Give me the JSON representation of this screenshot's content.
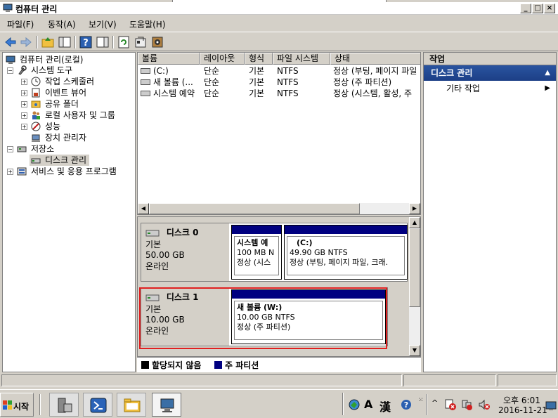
{
  "window": {
    "title": "컴퓨터 관리"
  },
  "menu": [
    "파일(F)",
    "동작(A)",
    "보기(V)",
    "도움말(H)"
  ],
  "tree": [
    {
      "label": "컴퓨터 관리(로컬)",
      "icon": "computer-management-icon"
    },
    {
      "label": "시스템 도구",
      "icon": "tools-icon"
    },
    {
      "label": "작업 스케줄러",
      "icon": "clock-icon"
    },
    {
      "label": "이벤트 뷰어",
      "icon": "event-viewer-icon"
    },
    {
      "label": "공유 폴더",
      "icon": "shared-folder-icon"
    },
    {
      "label": "로컬 사용자 및 그룹",
      "icon": "users-icon"
    },
    {
      "label": "성능",
      "icon": "performance-icon"
    },
    {
      "label": "장치 관리자",
      "icon": "device-manager-icon"
    },
    {
      "label": "저장소",
      "icon": "storage-icon"
    },
    {
      "label": "디스크 관리",
      "icon": "disk-icon"
    },
    {
      "label": "서비스 및 응용 프로그램",
      "icon": "services-icon"
    }
  ],
  "volume_table": {
    "columns": [
      "볼륨",
      "레이아웃",
      "형식",
      "파일 시스템",
      "상태"
    ],
    "rows": [
      [
        "(C:)",
        "단순",
        "기본",
        "NTFS",
        "정상 (부팅, 페이지 파일"
      ],
      [
        "새 볼륨 (...",
        "단순",
        "기본",
        "NTFS",
        "정상 (주 파티션)"
      ],
      [
        "시스템 예약",
        "단순",
        "기본",
        "NTFS",
        "정상 (시스템, 활성, 주"
      ]
    ]
  },
  "disks": [
    {
      "name": "디스크 0",
      "type": "기본",
      "size": "50.00 GB",
      "status": "온라인",
      "partitions": [
        {
          "title": "시스템 예",
          "line1": "100 MB N",
          "line2": "정상 (시스"
        },
        {
          "title": "(C:)",
          "line1": "49.90 GB NTFS",
          "line2": "정상 (부팅, 페이지 파일, 크래."
        }
      ]
    },
    {
      "name": "디스크 1",
      "type": "기본",
      "size": "10.00 GB",
      "status": "온라인",
      "partitions": [
        {
          "title": "새 볼륨  (W:)",
          "line1": "10.00 GB NTFS",
          "line2": "정상 (주 파티션)"
        }
      ]
    }
  ],
  "legend": [
    {
      "label": "할당되지 않음",
      "color": "#000000"
    },
    {
      "label": "주 파티션",
      "color": "#000080"
    }
  ],
  "actions": {
    "header": "작업",
    "section": "디스크 관리",
    "items": [
      "기타 작업"
    ]
  },
  "taskbar": {
    "start": "시작",
    "ime": [
      "A",
      "漢"
    ],
    "time": "오후 6:01",
    "date": "2016-11-21"
  },
  "colors": {
    "primary_partition": "#000080",
    "highlight_box": "#e02020",
    "actions_section": "#1c3f86"
  }
}
